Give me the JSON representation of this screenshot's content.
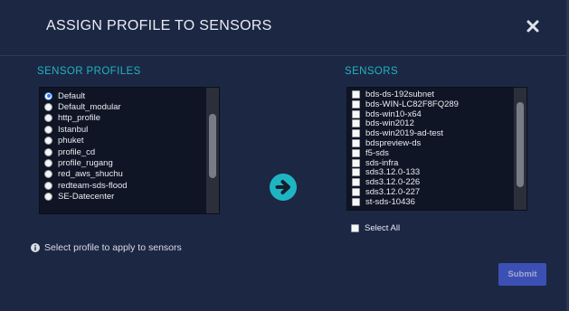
{
  "dialog": {
    "title": "ASSIGN PROFILE TO SENSORS",
    "close_icon": "close-icon"
  },
  "profiles": {
    "label": "SENSOR PROFILES",
    "selected": "Default",
    "items": [
      {
        "label": "Default",
        "selected": true
      },
      {
        "label": "Default_modular",
        "selected": false
      },
      {
        "label": "http_profile",
        "selected": false
      },
      {
        "label": "Istanbul",
        "selected": false
      },
      {
        "label": "phuket",
        "selected": false
      },
      {
        "label": "profile_cd",
        "selected": false
      },
      {
        "label": "profile_rugang",
        "selected": false
      },
      {
        "label": "red_aws_shuchu",
        "selected": false
      },
      {
        "label": "redteam-sds-flood",
        "selected": false
      },
      {
        "label": "SE-Datecenter",
        "selected": false
      }
    ]
  },
  "sensors": {
    "label": "SENSORS",
    "items": [
      {
        "label": "bds-ds-192subnet",
        "checked": false
      },
      {
        "label": "bds-WIN-LC82F8FQ289",
        "checked": false
      },
      {
        "label": "bds-win10-x64",
        "checked": false
      },
      {
        "label": "bds-win2012",
        "checked": false
      },
      {
        "label": "bds-win2019-ad-test",
        "checked": false
      },
      {
        "label": "bdspreview-ds",
        "checked": false
      },
      {
        "label": "f5-sds",
        "checked": false
      },
      {
        "label": "sds-infra",
        "checked": false
      },
      {
        "label": "sds3.12.0-133",
        "checked": false
      },
      {
        "label": "sds3.12.0-226",
        "checked": false
      },
      {
        "label": "sds3.12.0-227",
        "checked": false
      },
      {
        "label": "st-sds-10436",
        "checked": false
      }
    ],
    "select_all_label": "Select All",
    "select_all_checked": false
  },
  "transfer": {
    "icon": "arrow-right-circle-icon"
  },
  "hint": {
    "icon": "info-circle-icon",
    "text": "Select profile to apply to sensors"
  },
  "actions": {
    "submit_label": "Submit",
    "submit_enabled": false
  },
  "colors": {
    "background": "#1c2743",
    "accent": "#1fb4c4",
    "list_background": "#0f1524",
    "submit": "#4257c9"
  }
}
